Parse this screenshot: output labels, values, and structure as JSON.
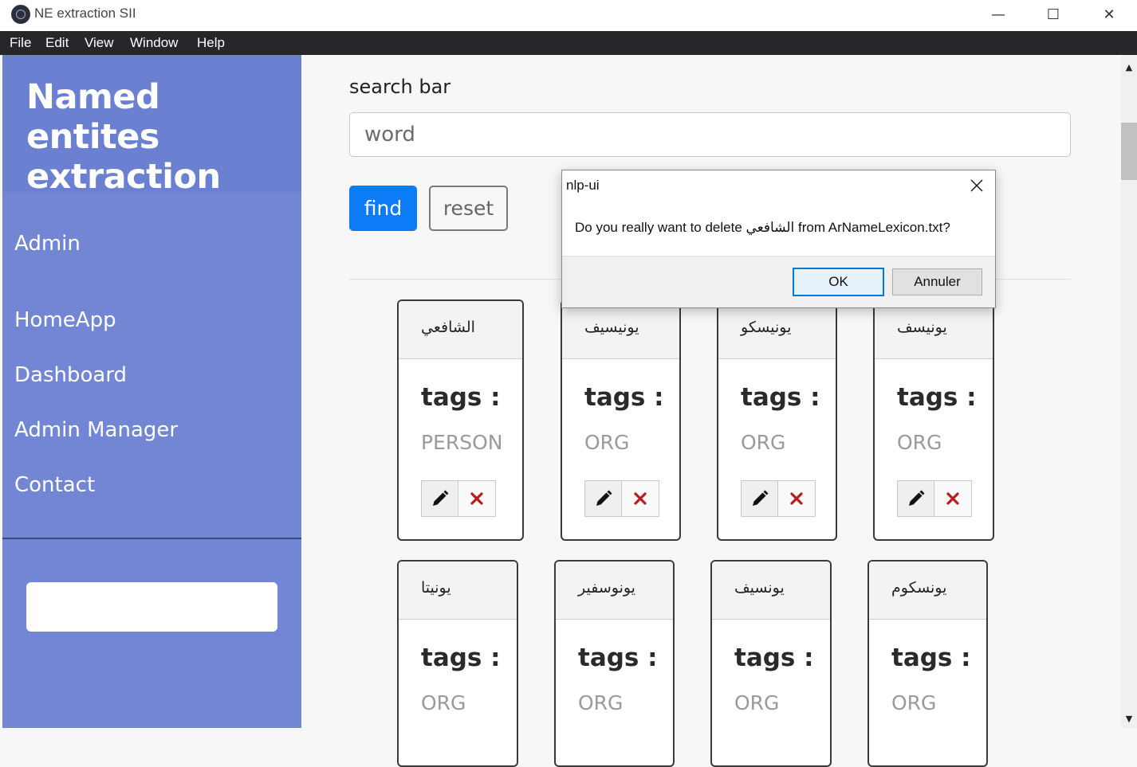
{
  "window": {
    "title": "NE extraction SII",
    "controls": {
      "minimize": "—",
      "maximize": "☐",
      "close": "✕"
    }
  },
  "menubar": {
    "items": [
      {
        "label": "File"
      },
      {
        "label": "Edit"
      },
      {
        "label": "View"
      },
      {
        "label": "Window"
      },
      {
        "label": "Help"
      }
    ]
  },
  "sidebar": {
    "title": "Named entites extraction",
    "admin": "Admin",
    "items": [
      {
        "label": "HomeApp"
      },
      {
        "label": "Dashboard"
      },
      {
        "label": "Admin Manager"
      },
      {
        "label": "Contact"
      }
    ],
    "box_value": ""
  },
  "search": {
    "label": "search bar",
    "placeholder": "word",
    "find_label": "find",
    "reset_label": "reset"
  },
  "cards": [
    {
      "word": "الشافعي",
      "tags_label": "tags :",
      "tag": "PERSON"
    },
    {
      "word": "يونيسيف",
      "tags_label": "tags :",
      "tag": "ORG"
    },
    {
      "word": "يونيسكو",
      "tags_label": "tags :",
      "tag": "ORG"
    },
    {
      "word": "يونيسف",
      "tags_label": "tags :",
      "tag": "ORG"
    },
    {
      "word": "يونيتا",
      "tags_label": "tags :",
      "tag": "ORG"
    },
    {
      "word": "يونوسفير",
      "tags_label": "tags :",
      "tag": "ORG"
    },
    {
      "word": "يونسيف",
      "tags_label": "tags :",
      "tag": "ORG"
    },
    {
      "word": "يونسكوم",
      "tags_label": "tags :",
      "tag": "ORG"
    }
  ],
  "dialog": {
    "title": "nlp-ui",
    "message": "Do you really want to delete الشافعي from ArNameLexicon.txt?",
    "ok_label": "OK",
    "cancel_label": "Annuler"
  },
  "colors": {
    "sidebar": "#7286d3",
    "sidebar_header": "#6b80d0",
    "find_button": "#0b7cf6",
    "delete_icon": "#b81c1c",
    "menubar": "#25272b"
  }
}
